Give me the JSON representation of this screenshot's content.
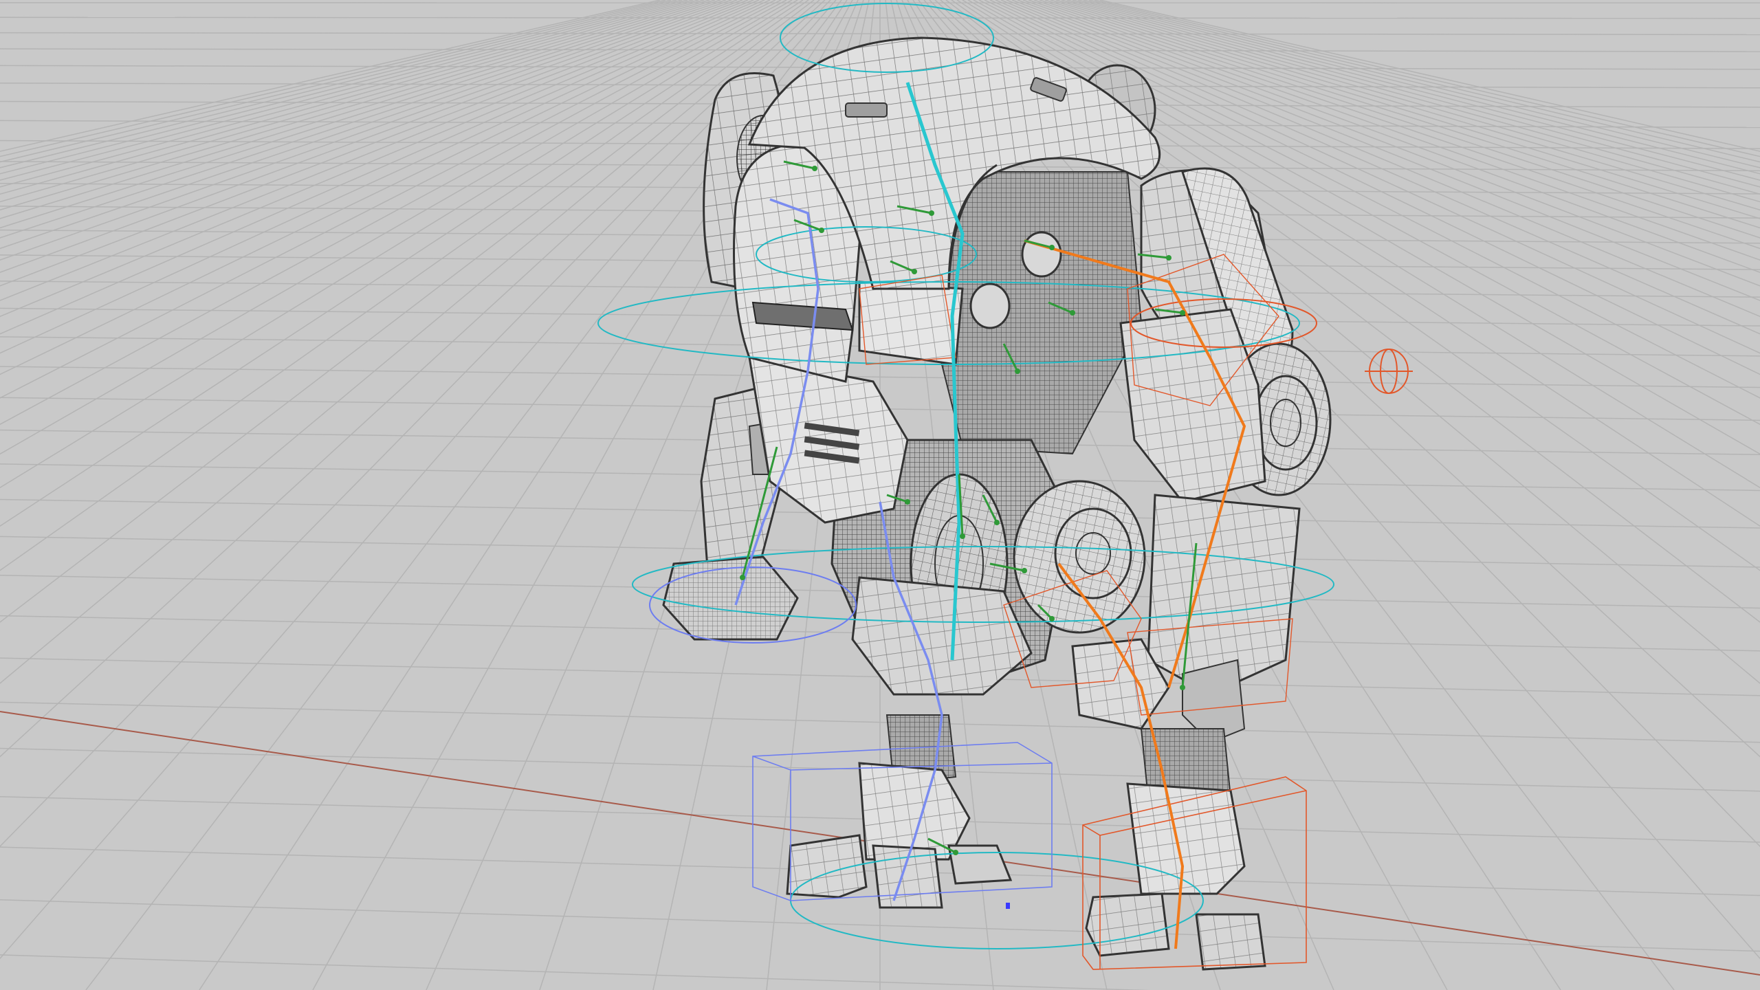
{
  "viewport": {
    "background": "#c9c9c9",
    "grid_color": "#b4b4b4",
    "x_axis_color": "#a85a4a",
    "origin_marker_color": "#3a3aff"
  },
  "model": {
    "name": "robot-mech-wireframe",
    "shell_fill": "#dddddd",
    "shell_dark_fill": "#b9b9b9",
    "wire_color": "#3a3a3a",
    "mechanical_fill": "#9a9a9a"
  },
  "rig": {
    "spine_color": "#29c7cf",
    "left_chain_color": "#7a8cf0",
    "right_chain_color": "#f07a1c",
    "helper_bone_color": "#2f9a38",
    "control_left_color": "#6d7df0",
    "control_right_color": "#e2572a",
    "control_center_color": "#22b9c4",
    "pole_target_icon": "gimbal-icon"
  }
}
